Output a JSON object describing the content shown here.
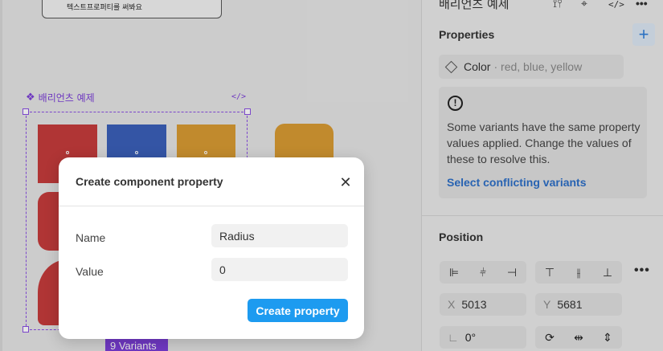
{
  "canvas": {
    "sticky_note_text": "텍스트프로퍼티를 써봐요",
    "component_set_name": "배리언츠 예제",
    "code_glyph": "</>",
    "variants_badge": "9 Variants"
  },
  "colors": {
    "red": "#c53b3c",
    "blue": "#3a5fb8",
    "orange": "#d79a33",
    "component_purple": "#7c3fd8",
    "primary_button": "#1d9bf0",
    "link_blue": "#2d6fc7"
  },
  "panel": {
    "title": "배리언츠 예제",
    "top_icons": [
      "adjust-icon",
      "component-icon",
      "code-icon",
      "more-icon"
    ],
    "properties": {
      "heading": "Properties",
      "add_icon": "plus-icon",
      "items": [
        {
          "name": "Color",
          "values": "red, blue, yellow"
        }
      ],
      "warning": {
        "text": "Some variants have the same property values applied. Change the values of these to resolve this.",
        "link": "Select conflicting variants"
      }
    },
    "position": {
      "heading": "Position",
      "x_label": "X",
      "x_value": "5013",
      "y_label": "Y",
      "y_value": "5681",
      "rotation": "0°"
    }
  },
  "modal": {
    "title": "Create component property",
    "name_label": "Name",
    "name_value": "Radius",
    "value_label": "Value",
    "value_value": "0",
    "submit_label": "Create property"
  }
}
